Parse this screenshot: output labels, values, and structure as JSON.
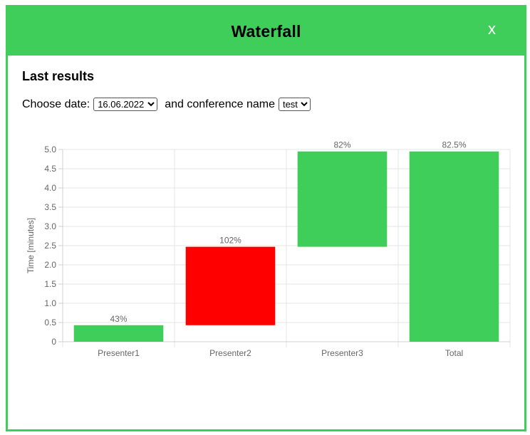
{
  "modal": {
    "title": "Waterfall",
    "close_label": "x",
    "header_color": "#3fce5a"
  },
  "section": {
    "title": "Last results"
  },
  "filters": {
    "date_label": "Choose date:",
    "date_value": "16.06.2022",
    "conference_label": "and conference name",
    "conference_value": "test"
  },
  "chart_data": {
    "type": "bar",
    "subtype": "waterfall",
    "categories": [
      "Presenter1",
      "Presenter2",
      "Presenter3",
      "Total"
    ],
    "ranges": [
      [
        0,
        0.43
      ],
      [
        0.43,
        2.47
      ],
      [
        2.47,
        4.95
      ],
      [
        0,
        4.95
      ]
    ],
    "data_labels": [
      "43%",
      "102%",
      "82%",
      "82.5%"
    ],
    "colors": [
      "#3fce5a",
      "#ff0000",
      "#3fce5a",
      "#3fce5a"
    ],
    "ylabel": "Time [minutes]",
    "xlabel": "",
    "ylim": [
      0,
      5.0
    ],
    "yticks": [
      "0",
      "0.5",
      "1.0",
      "1.5",
      "2.0",
      "2.5",
      "3.0",
      "3.5",
      "4.0",
      "4.5",
      "5.0"
    ],
    "grid": true,
    "legend": "none"
  }
}
